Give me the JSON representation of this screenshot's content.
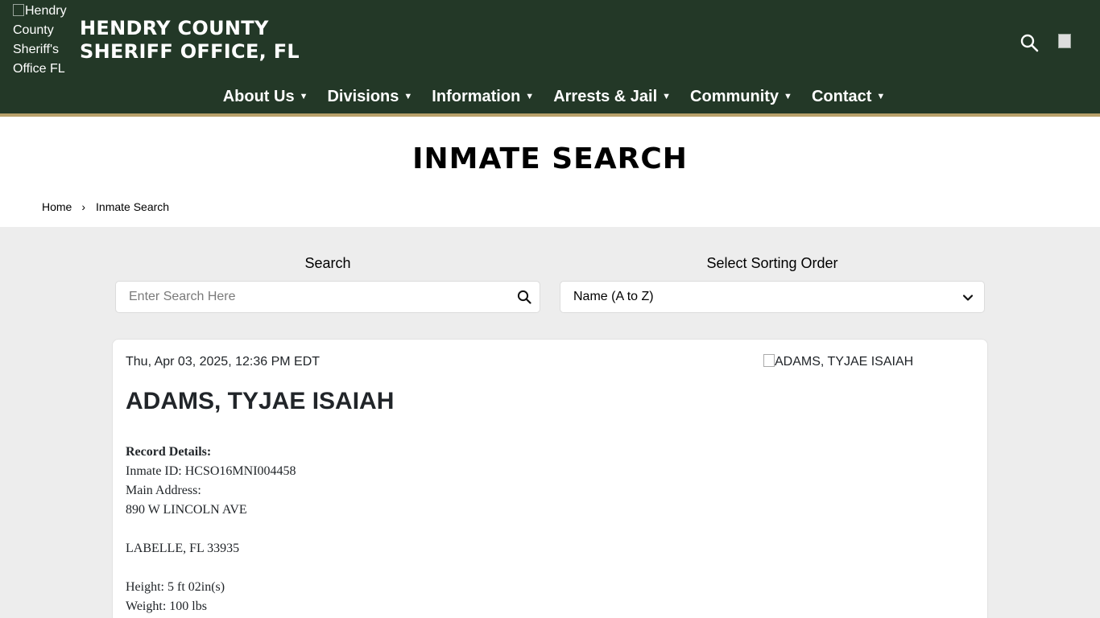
{
  "header": {
    "logo_alt": "Hendry County Sheriff's Office FL",
    "site_title_line1": "HENDRY COUNTY",
    "site_title_line2": "SHERIFF OFFICE, FL",
    "nav": [
      {
        "label": "About Us"
      },
      {
        "label": "Divisions"
      },
      {
        "label": "Information"
      },
      {
        "label": "Arrests & Jail"
      },
      {
        "label": "Community"
      },
      {
        "label": "Contact"
      }
    ]
  },
  "page": {
    "title": "INMATE SEARCH",
    "breadcrumb": {
      "home": "Home",
      "current": "Inmate Search"
    }
  },
  "search": {
    "label": "Search",
    "placeholder": "Enter Search Here",
    "sort_label": "Select Sorting Order",
    "sort_value": "Name (A to Z)"
  },
  "record": {
    "timestamp": "Thu, Apr 03, 2025, 12:36 PM EDT",
    "photo_alt": "ADAMS, TYJAE ISAIAH",
    "name": "ADAMS, TYJAE ISAIAH",
    "details_heading": "Record Details:",
    "inmate_id": "Inmate ID: HCSO16MNI004458",
    "address_label": "Main Address:",
    "address_line1": "890 W LINCOLN AVE",
    "address_line2": "LABELLE, FL 33935",
    "height": "Height: 5 ft 02in(s)",
    "weight": "Weight: 100 lbs"
  },
  "colors": {
    "header_bg": "#233827",
    "header_accent": "#b8a06a",
    "page_bg": "#ededed"
  }
}
